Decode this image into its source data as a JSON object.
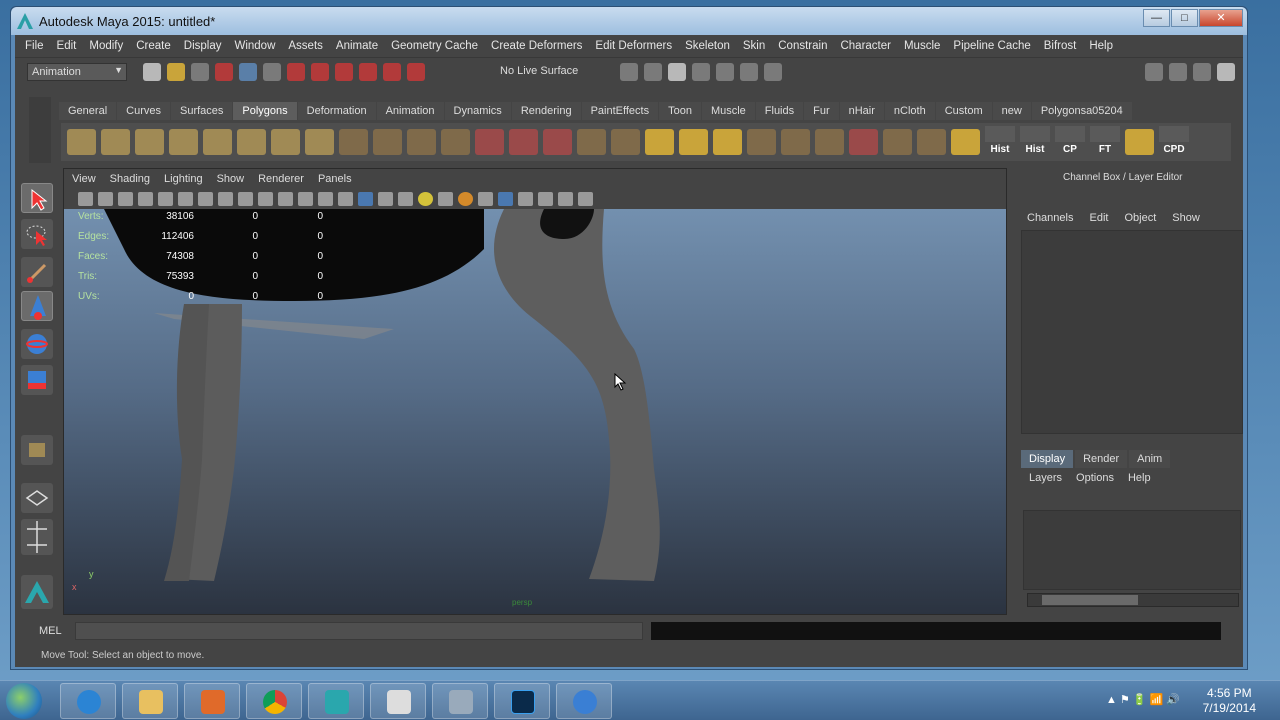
{
  "window": {
    "title": "Autodesk Maya 2015: untitled*",
    "minimize": "—",
    "maximize": "□",
    "close": "✕"
  },
  "menubar": [
    "File",
    "Edit",
    "Modify",
    "Create",
    "Display",
    "Window",
    "Assets",
    "Animate",
    "Geometry Cache",
    "Create Deformers",
    "Edit Deformers",
    "Skeleton",
    "Skin",
    "Constrain",
    "Character",
    "Muscle",
    "Pipeline Cache",
    "Bifrost",
    "Help"
  ],
  "statusline": {
    "mode": "Animation",
    "live_surface": "No Live Surface"
  },
  "shelf": {
    "tabs": [
      "General",
      "Curves",
      "Surfaces",
      "Polygons",
      "Deformation",
      "Animation",
      "Dynamics",
      "Rendering",
      "PaintEffects",
      "Toon",
      "Muscle",
      "Fluids",
      "Fur",
      "nHair",
      "nCloth",
      "Custom",
      "new",
      "Polygonsa05204"
    ],
    "active_tab": "Polygons",
    "labeled_buttons": [
      "Hist",
      "Hist",
      "CP",
      "FT",
      "CPD"
    ]
  },
  "viewport": {
    "menu": [
      "View",
      "Shading",
      "Lighting",
      "Show",
      "Renderer",
      "Panels"
    ],
    "hud": [
      {
        "label": "Verts:",
        "v1": "38106",
        "v2": "0",
        "v3": "0"
      },
      {
        "label": "Edges:",
        "v1": "112406",
        "v2": "0",
        "v3": "0"
      },
      {
        "label": "Faces:",
        "v1": "74308",
        "v2": "0",
        "v3": "0"
      },
      {
        "label": "Tris:",
        "v1": "75393",
        "v2": "0",
        "v3": "0"
      },
      {
        "label": "UVs:",
        "v1": "0",
        "v2": "0",
        "v3": "0"
      }
    ],
    "axis_y": "y",
    "axis_x": "x",
    "camera": "persp"
  },
  "channel_box": {
    "title": "Channel Box / Layer Editor",
    "menu": [
      "Channels",
      "Edit",
      "Object",
      "Show"
    ],
    "tabs": [
      "Display",
      "Render",
      "Anim"
    ],
    "active_tab": "Display",
    "layer_menu": [
      "Layers",
      "Options",
      "Help"
    ]
  },
  "command_line": {
    "label": "MEL"
  },
  "help_line": "Move Tool: Select an object to move.",
  "taskbar": {
    "time": "4:56 PM",
    "date": "7/19/2014"
  }
}
